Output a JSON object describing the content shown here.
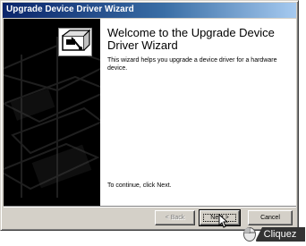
{
  "window": {
    "title": "Upgrade Device Driver Wizard"
  },
  "content": {
    "heading": "Welcome to the Upgrade Device Driver Wizard",
    "description": "This wizard helps you upgrade a device driver for a hardware device.",
    "continue_text": "To continue, click Next."
  },
  "buttons": {
    "back_label": "< Back",
    "next_label": "Next >",
    "cancel_label": "Cancel"
  },
  "overlay": {
    "badge_label": "Cliquez",
    "badge_color": "#333333",
    "badge_icon": "mouse-icon",
    "cursor_icon": "pointer-cursor-icon"
  },
  "colors": {
    "title_gradient_start": "#0a246a",
    "title_gradient_end": "#a6caf0",
    "dialog_face": "#d4d0c8",
    "side_panel": "#000000"
  }
}
